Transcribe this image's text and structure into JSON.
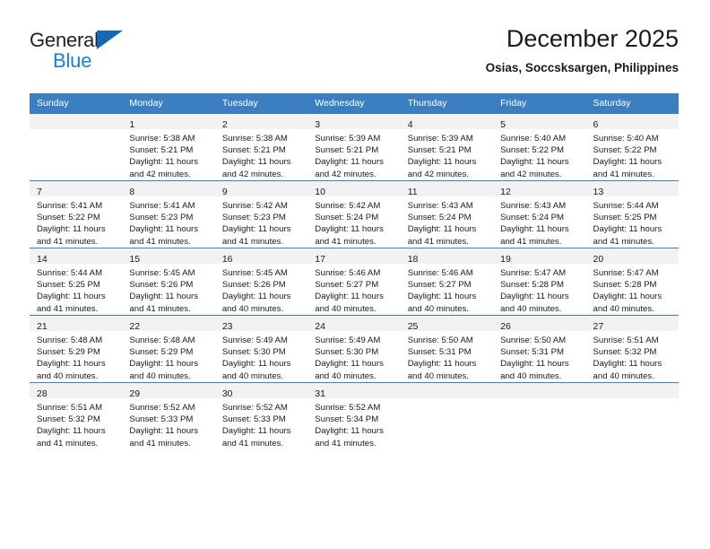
{
  "brand": {
    "name_part1": "General",
    "name_part2": "Blue",
    "accent_color": "#1a7fd4",
    "triangle_color": "#1668b3"
  },
  "header": {
    "title": "December 2025",
    "subtitle": "Osias, Soccsksargen, Philippines",
    "header_bg": "#3c7fc1",
    "daynum_band_bg": "#f2f2f2"
  },
  "weekday_headers": [
    "Sunday",
    "Monday",
    "Tuesday",
    "Wednesday",
    "Thursday",
    "Friday",
    "Saturday"
  ],
  "labels": {
    "sunrise_prefix": "Sunrise:",
    "sunset_prefix": "Sunset:",
    "daylight_prefix": "Daylight:"
  },
  "weeks": [
    [
      {
        "day": "",
        "empty": true,
        "sunrise": "",
        "sunset": "",
        "daylight_line1": "",
        "daylight_line2": ""
      },
      {
        "day": "1",
        "sunrise": "Sunrise: 5:38 AM",
        "sunset": "Sunset: 5:21 PM",
        "daylight_line1": "Daylight: 11 hours",
        "daylight_line2": "and 42 minutes."
      },
      {
        "day": "2",
        "sunrise": "Sunrise: 5:38 AM",
        "sunset": "Sunset: 5:21 PM",
        "daylight_line1": "Daylight: 11 hours",
        "daylight_line2": "and 42 minutes."
      },
      {
        "day": "3",
        "sunrise": "Sunrise: 5:39 AM",
        "sunset": "Sunset: 5:21 PM",
        "daylight_line1": "Daylight: 11 hours",
        "daylight_line2": "and 42 minutes."
      },
      {
        "day": "4",
        "sunrise": "Sunrise: 5:39 AM",
        "sunset": "Sunset: 5:21 PM",
        "daylight_line1": "Daylight: 11 hours",
        "daylight_line2": "and 42 minutes."
      },
      {
        "day": "5",
        "sunrise": "Sunrise: 5:40 AM",
        "sunset": "Sunset: 5:22 PM",
        "daylight_line1": "Daylight: 11 hours",
        "daylight_line2": "and 42 minutes."
      },
      {
        "day": "6",
        "sunrise": "Sunrise: 5:40 AM",
        "sunset": "Sunset: 5:22 PM",
        "daylight_line1": "Daylight: 11 hours",
        "daylight_line2": "and 41 minutes."
      }
    ],
    [
      {
        "day": "7",
        "sunrise": "Sunrise: 5:41 AM",
        "sunset": "Sunset: 5:22 PM",
        "daylight_line1": "Daylight: 11 hours",
        "daylight_line2": "and 41 minutes."
      },
      {
        "day": "8",
        "sunrise": "Sunrise: 5:41 AM",
        "sunset": "Sunset: 5:23 PM",
        "daylight_line1": "Daylight: 11 hours",
        "daylight_line2": "and 41 minutes."
      },
      {
        "day": "9",
        "sunrise": "Sunrise: 5:42 AM",
        "sunset": "Sunset: 5:23 PM",
        "daylight_line1": "Daylight: 11 hours",
        "daylight_line2": "and 41 minutes."
      },
      {
        "day": "10",
        "sunrise": "Sunrise: 5:42 AM",
        "sunset": "Sunset: 5:24 PM",
        "daylight_line1": "Daylight: 11 hours",
        "daylight_line2": "and 41 minutes."
      },
      {
        "day": "11",
        "sunrise": "Sunrise: 5:43 AM",
        "sunset": "Sunset: 5:24 PM",
        "daylight_line1": "Daylight: 11 hours",
        "daylight_line2": "and 41 minutes."
      },
      {
        "day": "12",
        "sunrise": "Sunrise: 5:43 AM",
        "sunset": "Sunset: 5:24 PM",
        "daylight_line1": "Daylight: 11 hours",
        "daylight_line2": "and 41 minutes."
      },
      {
        "day": "13",
        "sunrise": "Sunrise: 5:44 AM",
        "sunset": "Sunset: 5:25 PM",
        "daylight_line1": "Daylight: 11 hours",
        "daylight_line2": "and 41 minutes."
      }
    ],
    [
      {
        "day": "14",
        "sunrise": "Sunrise: 5:44 AM",
        "sunset": "Sunset: 5:25 PM",
        "daylight_line1": "Daylight: 11 hours",
        "daylight_line2": "and 41 minutes."
      },
      {
        "day": "15",
        "sunrise": "Sunrise: 5:45 AM",
        "sunset": "Sunset: 5:26 PM",
        "daylight_line1": "Daylight: 11 hours",
        "daylight_line2": "and 41 minutes."
      },
      {
        "day": "16",
        "sunrise": "Sunrise: 5:45 AM",
        "sunset": "Sunset: 5:26 PM",
        "daylight_line1": "Daylight: 11 hours",
        "daylight_line2": "and 40 minutes."
      },
      {
        "day": "17",
        "sunrise": "Sunrise: 5:46 AM",
        "sunset": "Sunset: 5:27 PM",
        "daylight_line1": "Daylight: 11 hours",
        "daylight_line2": "and 40 minutes."
      },
      {
        "day": "18",
        "sunrise": "Sunrise: 5:46 AM",
        "sunset": "Sunset: 5:27 PM",
        "daylight_line1": "Daylight: 11 hours",
        "daylight_line2": "and 40 minutes."
      },
      {
        "day": "19",
        "sunrise": "Sunrise: 5:47 AM",
        "sunset": "Sunset: 5:28 PM",
        "daylight_line1": "Daylight: 11 hours",
        "daylight_line2": "and 40 minutes."
      },
      {
        "day": "20",
        "sunrise": "Sunrise: 5:47 AM",
        "sunset": "Sunset: 5:28 PM",
        "daylight_line1": "Daylight: 11 hours",
        "daylight_line2": "and 40 minutes."
      }
    ],
    [
      {
        "day": "21",
        "sunrise": "Sunrise: 5:48 AM",
        "sunset": "Sunset: 5:29 PM",
        "daylight_line1": "Daylight: 11 hours",
        "daylight_line2": "and 40 minutes."
      },
      {
        "day": "22",
        "sunrise": "Sunrise: 5:48 AM",
        "sunset": "Sunset: 5:29 PM",
        "daylight_line1": "Daylight: 11 hours",
        "daylight_line2": "and 40 minutes."
      },
      {
        "day": "23",
        "sunrise": "Sunrise: 5:49 AM",
        "sunset": "Sunset: 5:30 PM",
        "daylight_line1": "Daylight: 11 hours",
        "daylight_line2": "and 40 minutes."
      },
      {
        "day": "24",
        "sunrise": "Sunrise: 5:49 AM",
        "sunset": "Sunset: 5:30 PM",
        "daylight_line1": "Daylight: 11 hours",
        "daylight_line2": "and 40 minutes."
      },
      {
        "day": "25",
        "sunrise": "Sunrise: 5:50 AM",
        "sunset": "Sunset: 5:31 PM",
        "daylight_line1": "Daylight: 11 hours",
        "daylight_line2": "and 40 minutes."
      },
      {
        "day": "26",
        "sunrise": "Sunrise: 5:50 AM",
        "sunset": "Sunset: 5:31 PM",
        "daylight_line1": "Daylight: 11 hours",
        "daylight_line2": "and 40 minutes."
      },
      {
        "day": "27",
        "sunrise": "Sunrise: 5:51 AM",
        "sunset": "Sunset: 5:32 PM",
        "daylight_line1": "Daylight: 11 hours",
        "daylight_line2": "and 40 minutes."
      }
    ],
    [
      {
        "day": "28",
        "sunrise": "Sunrise: 5:51 AM",
        "sunset": "Sunset: 5:32 PM",
        "daylight_line1": "Daylight: 11 hours",
        "daylight_line2": "and 41 minutes."
      },
      {
        "day": "29",
        "sunrise": "Sunrise: 5:52 AM",
        "sunset": "Sunset: 5:33 PM",
        "daylight_line1": "Daylight: 11 hours",
        "daylight_line2": "and 41 minutes."
      },
      {
        "day": "30",
        "sunrise": "Sunrise: 5:52 AM",
        "sunset": "Sunset: 5:33 PM",
        "daylight_line1": "Daylight: 11 hours",
        "daylight_line2": "and 41 minutes."
      },
      {
        "day": "31",
        "sunrise": "Sunrise: 5:52 AM",
        "sunset": "Sunset: 5:34 PM",
        "daylight_line1": "Daylight: 11 hours",
        "daylight_line2": "and 41 minutes."
      },
      {
        "day": "",
        "empty": true,
        "sunrise": "",
        "sunset": "",
        "daylight_line1": "",
        "daylight_line2": ""
      },
      {
        "day": "",
        "empty": true,
        "sunrise": "",
        "sunset": "",
        "daylight_line1": "",
        "daylight_line2": ""
      },
      {
        "day": "",
        "empty": true,
        "sunrise": "",
        "sunset": "",
        "daylight_line1": "",
        "daylight_line2": ""
      }
    ]
  ]
}
